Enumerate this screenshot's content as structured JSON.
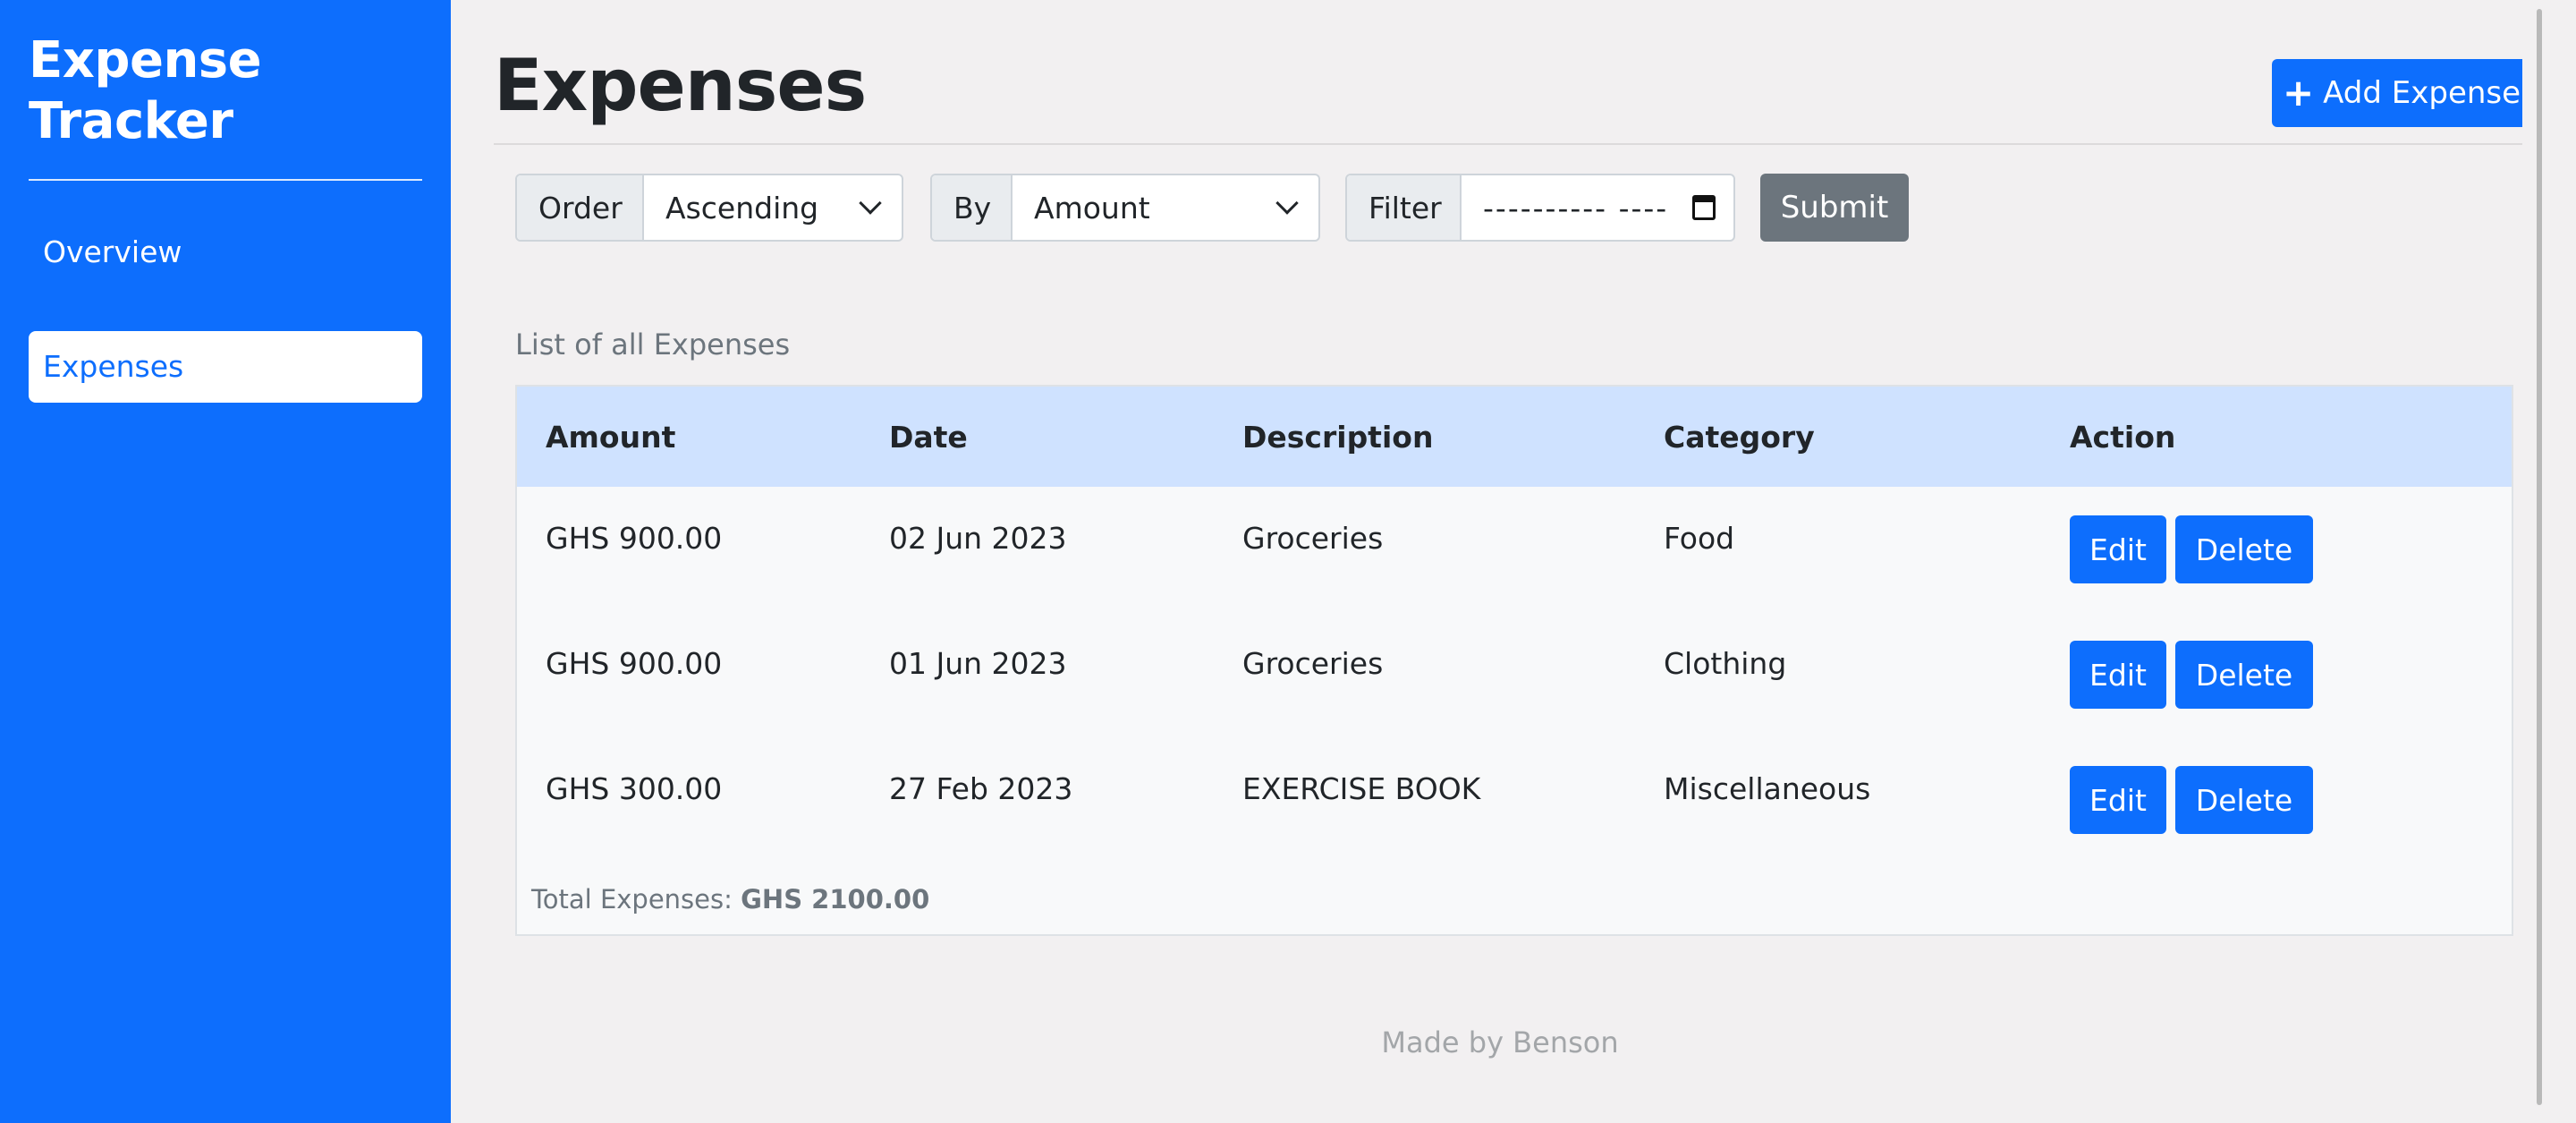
{
  "sidebar": {
    "brand_line1": "Expense",
    "brand_line2": "Tracker",
    "items": [
      {
        "label": "Overview",
        "active": false
      },
      {
        "label": "Expenses",
        "active": true
      }
    ]
  },
  "header": {
    "title": "Expenses",
    "add_button_label": "Add Expense",
    "add_icon": "plus-icon"
  },
  "controls": {
    "order_label": "Order",
    "order_value": "Ascending",
    "by_label": "By",
    "by_value": "Amount",
    "filter_label": "Filter",
    "filter_value": "---------- ----",
    "submit_label": "Submit"
  },
  "table": {
    "caption": "List of all Expenses",
    "columns": [
      "Amount",
      "Date",
      "Description",
      "Category",
      "Action"
    ],
    "rows": [
      {
        "amount": "GHS 900.00",
        "date": "02 Jun 2023",
        "description": "Groceries",
        "category": "Food"
      },
      {
        "amount": "GHS 900.00",
        "date": "01 Jun 2023",
        "description": "Groceries",
        "category": "Clothing"
      },
      {
        "amount": "GHS 300.00",
        "date": "27 Feb 2023",
        "description": "EXERCISE BOOK",
        "category": "Miscellaneous"
      }
    ],
    "edit_label": "Edit",
    "delete_label": "Delete",
    "total_label": "Total Expenses:",
    "total_value": "GHS 2100.00"
  },
  "footer": {
    "text": "Made by Benson"
  },
  "colors": {
    "primary": "#0d6efd",
    "secondary": "#6c757d",
    "table_header": "#cfe2ff",
    "background": "#f2f0f1"
  }
}
